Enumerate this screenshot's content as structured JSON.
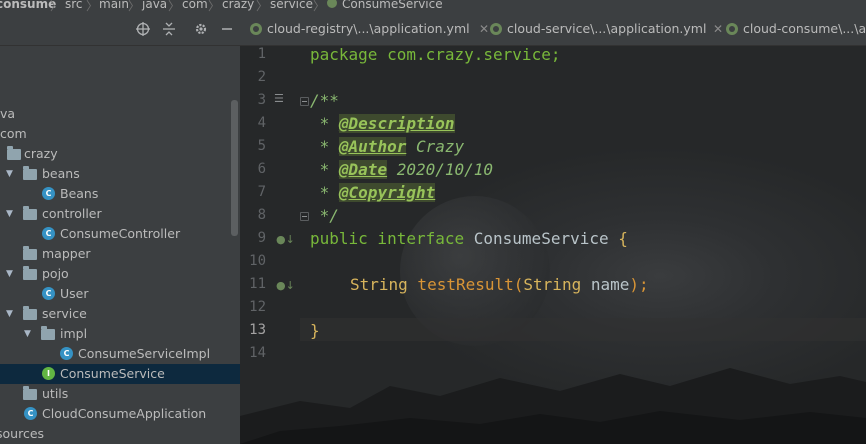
{
  "breadcrumb": {
    "items": [
      "consume",
      "src",
      "main",
      "java",
      "com",
      "crazy",
      "service",
      "ConsumeService"
    ],
    "separator": "〉"
  },
  "project_header": {
    "icons": [
      "crosshair-icon",
      "collapse-icon",
      "gear-icon",
      "minimize-icon"
    ]
  },
  "tree": {
    "items": [
      {
        "label": "va",
        "type": "text"
      },
      {
        "label": "com",
        "type": "folder"
      },
      {
        "label": "crazy",
        "type": "folder"
      },
      {
        "label": "beans",
        "type": "folder"
      },
      {
        "label": "Beans",
        "type": "class"
      },
      {
        "label": "controller",
        "type": "folder"
      },
      {
        "label": "ConsumeController",
        "type": "class"
      },
      {
        "label": "mapper",
        "type": "folder"
      },
      {
        "label": "pojo",
        "type": "folder"
      },
      {
        "label": "User",
        "type": "class"
      },
      {
        "label": "service",
        "type": "folder"
      },
      {
        "label": "impl",
        "type": "folder"
      },
      {
        "label": "ConsumeServiceImpl",
        "type": "class"
      },
      {
        "label": "ConsumeService",
        "type": "interface"
      },
      {
        "label": "utils",
        "type": "folder"
      },
      {
        "label": "CloudConsumeApplication",
        "type": "class"
      },
      {
        "label": "sources",
        "type": "folder"
      }
    ],
    "selected": "ConsumeService"
  },
  "tabs": [
    {
      "label": "cloud-registry\\...\\application.yml"
    },
    {
      "label": "cloud-service\\...\\application.yml"
    },
    {
      "label": "cloud-consume\\...\\ap"
    }
  ],
  "editor": {
    "line_numbers": [
      "1",
      "2",
      "3",
      "4",
      "5",
      "6",
      "7",
      "8",
      "9",
      "10",
      "11",
      "12",
      "13",
      "14"
    ],
    "current_line": "13",
    "code": {
      "l1_kw": "package",
      "l1_pkg": " com.crazy.service;",
      "l3": "/**",
      "l4_star": " * ",
      "l4_tag": "@Description",
      "l5_star": " * ",
      "l5_tag": "@Author",
      "l5_val": " Crazy",
      "l6_star": " * ",
      "l6_tag": "@Date",
      "l6_val": " 2020/10/10",
      "l7_star": " * ",
      "l7_tag": "@Copyright",
      "l8": " */",
      "l9_kw1": "public",
      "l9_kw2": " interface",
      "l9_name": " ConsumeService ",
      "l9_brace": "{",
      "l11_type": "String",
      "l11_method": " testResult",
      "l11_paren_open": "(",
      "l11_ptype": "String",
      "l11_pname": " name",
      "l11_end": ");",
      "l13": "}"
    }
  }
}
